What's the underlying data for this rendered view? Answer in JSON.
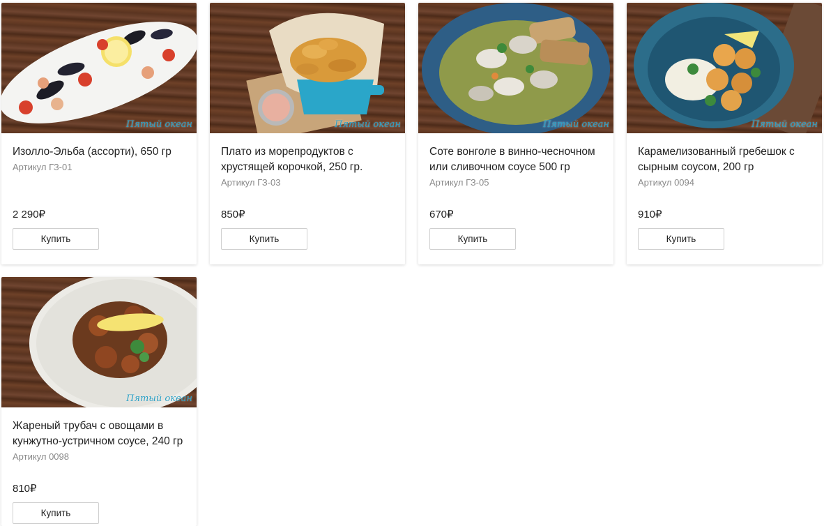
{
  "currency": "₽",
  "buy_label": "Купить",
  "logo_text": "Пятый океан",
  "products": [
    {
      "title": "Изолло-Эльба (ассорти), 650 гр",
      "sku": "Артикул ГЗ-01",
      "price": "2 290₽"
    },
    {
      "title": "Плато из морепродуктов с хрустящей корочкой, 250 гр.",
      "sku": "Артикул ГЗ-03",
      "price": "850₽"
    },
    {
      "title": "Соте вонголе в винно-чесночном или сливочном соусе 500 гр",
      "sku": "Артикул ГЗ-05",
      "price": "670₽"
    },
    {
      "title": "Карамелизованный гребешок с сырным соусом, 200 гр",
      "sku": "Артикул 0094",
      "price": "910₽"
    },
    {
      "title": "Жареный трубач с овощами в кунжутно-устричном соусе, 240 гр",
      "sku": "Артикул 0098",
      "price": "810₽"
    }
  ]
}
